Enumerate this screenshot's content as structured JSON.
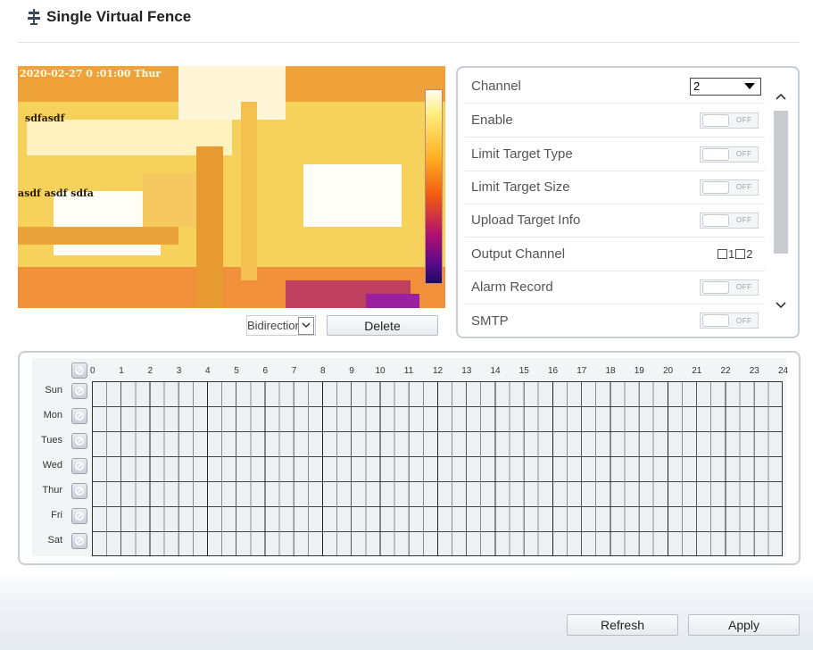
{
  "header": {
    "title": "Single Virtual Fence",
    "icon": "fence-pole-icon"
  },
  "video": {
    "osd_time": "2020-02-27 0 :01:00 Thur",
    "osd_text_1": "sdfasdf",
    "osd_text_2": "asdf asdf sdfa"
  },
  "rule": {
    "direction_value": "Bidirectional",
    "delete_label": "Delete"
  },
  "settings": {
    "channel": {
      "label": "Channel",
      "value": "2"
    },
    "enable": {
      "label": "Enable",
      "toggle": "OFF"
    },
    "limit_target_type": {
      "label": "Limit Target Type",
      "toggle": "OFF"
    },
    "limit_target_size": {
      "label": "Limit Target Size",
      "toggle": "OFF"
    },
    "upload_target_info": {
      "label": "Upload Target Info",
      "toggle": "OFF"
    },
    "output_channel": {
      "label": "Output Channel",
      "opt1": "1",
      "opt2": "2"
    },
    "alarm_record": {
      "label": "Alarm Record",
      "toggle": "OFF"
    },
    "smtp": {
      "label": "SMTP",
      "toggle": "OFF"
    }
  },
  "schedule": {
    "hours": [
      "0",
      "1",
      "2",
      "3",
      "4",
      "5",
      "6",
      "7",
      "8",
      "9",
      "10",
      "11",
      "12",
      "13",
      "14",
      "15",
      "16",
      "17",
      "18",
      "19",
      "20",
      "21",
      "22",
      "23",
      "24"
    ],
    "days": [
      "Sun",
      "Mon",
      "Tues",
      "Wed",
      "Thur",
      "Fri",
      "Sat"
    ]
  },
  "footer": {
    "refresh_label": "Refresh",
    "apply_label": "Apply"
  }
}
